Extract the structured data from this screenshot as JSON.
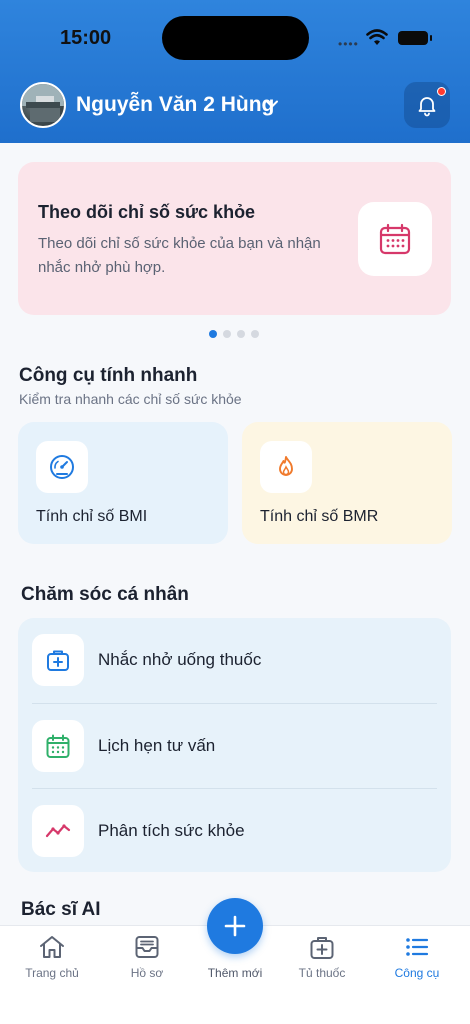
{
  "status": {
    "time": "15:00",
    "signal": "••••"
  },
  "header": {
    "user_name": "Nguyễn Văn 2 Hùng"
  },
  "banner": {
    "title": "Theo dõi chỉ số sức khỏe",
    "description": "Theo dõi chỉ số sức khỏe của bạn và nhận nhắc nhở phù hợp.",
    "icon": "calendar-icon",
    "page_count": 4,
    "active_page": 1
  },
  "quick_tools": {
    "title": "Công cụ tính nhanh",
    "subtitle": "Kiểm tra nhanh các chỉ số sức khỏe",
    "items": [
      {
        "label": "Tính chỉ số BMI",
        "icon": "gauge-icon"
      },
      {
        "label": "Tính chỉ số BMR",
        "icon": "flame-icon"
      }
    ]
  },
  "personal_care": {
    "title": "Chăm sóc cá nhân",
    "items": [
      {
        "label": "Nhắc nhở uống thuốc",
        "icon": "medkit-icon"
      },
      {
        "label": "Lịch hẹn tư vấn",
        "icon": "calendar-icon"
      },
      {
        "label": "Phân tích sức khỏe",
        "icon": "trend-icon"
      }
    ]
  },
  "ai_section": {
    "title": "Bác sĩ AI"
  },
  "tabbar": {
    "items": [
      {
        "label": "Trang chủ",
        "icon": "home-icon"
      },
      {
        "label": "Hồ sơ",
        "icon": "inbox-icon"
      },
      {
        "label": "Thêm mới",
        "icon": "plus-icon"
      },
      {
        "label": "Tủ thuốc",
        "icon": "medkit-icon"
      },
      {
        "label": "Công cụ",
        "icon": "list-icon"
      }
    ],
    "active": "Công cụ"
  },
  "colors": {
    "primary": "#1f7ae0",
    "header": "#2f84dd",
    "banner_bg": "#fbe4ea",
    "banner_icon": "#d6386a",
    "bmi_bg": "#e6f2fb",
    "bmr_bg": "#fdf6e3",
    "care_bg": "#e7f2fa",
    "notification_dot": "#ff3b30"
  }
}
